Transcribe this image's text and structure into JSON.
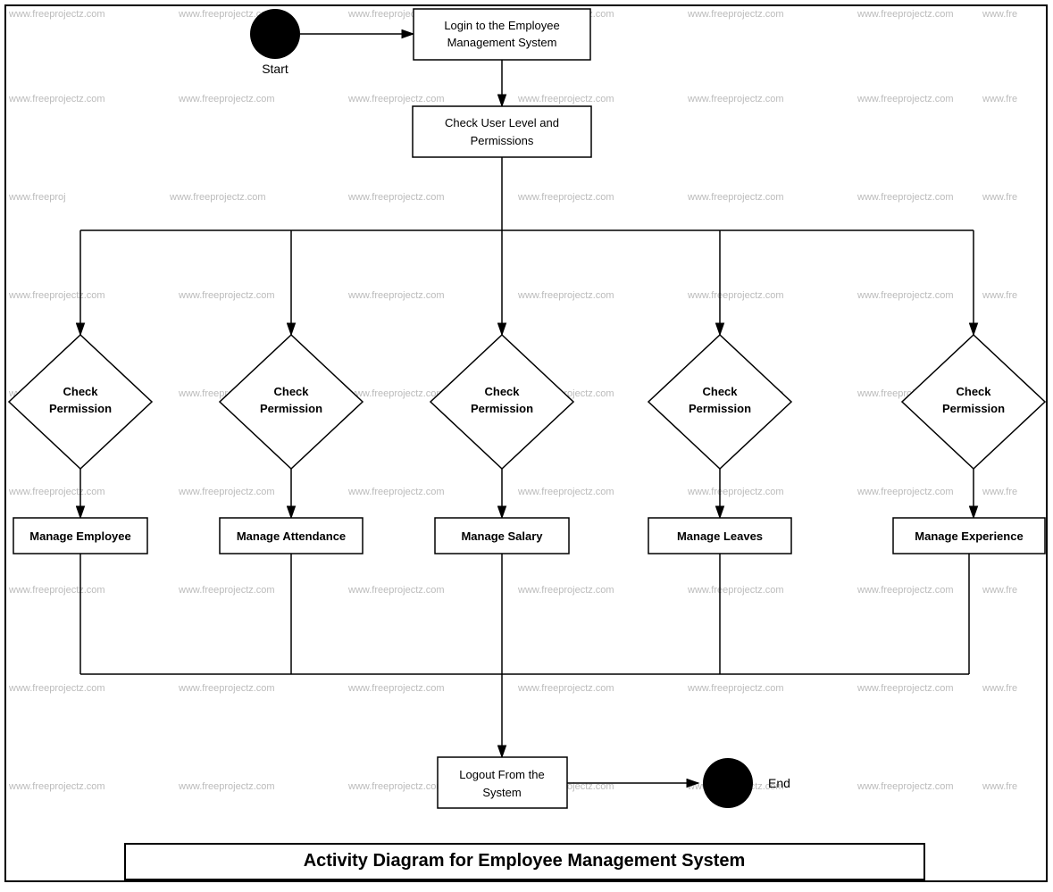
{
  "diagram": {
    "title": "Activity Diagram for Employee Management System",
    "watermark": "www.freeprojectz.com",
    "nodes": {
      "start_label": "Start",
      "end_label": "End",
      "login": "Login to the Employee\nManagement System",
      "check_user_level": "Check User Level and\nPermissions",
      "check_perm_1": "Check\nPermission",
      "check_perm_2": "Check\nPermission",
      "check_perm_3": "Check\nPermission",
      "check_perm_4": "Check\nPermission",
      "check_perm_5": "Check\nPermission",
      "manage_employee": "Manage Employee",
      "manage_attendance": "Manage Attendance",
      "manage_salary": "Manage Salary",
      "manage_leaves": "Manage Leaves",
      "manage_experience": "Manage Experience",
      "logout": "Logout From the\nSystem"
    }
  }
}
